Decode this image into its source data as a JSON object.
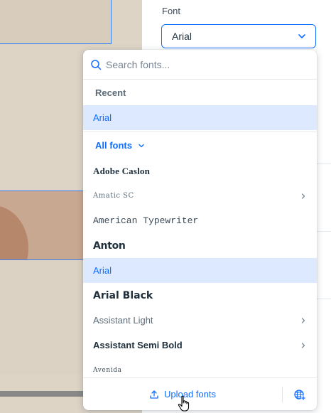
{
  "panel": {
    "label": "Font",
    "selected_value": "Arial"
  },
  "search": {
    "placeholder": "Search fonts..."
  },
  "recent": {
    "title": "Recent",
    "items": [
      {
        "label": "Arial",
        "selected": true
      }
    ]
  },
  "all_fonts": {
    "title": "All fonts",
    "items": [
      {
        "label": "Adobe Caslon"
      },
      {
        "label": "Amatic SC",
        "has_submenu": true
      },
      {
        "label": "American Typewriter"
      },
      {
        "label": "Anton"
      },
      {
        "label": "Arial",
        "selected": true
      },
      {
        "label": "Arial Black"
      },
      {
        "label": "Assistant Light",
        "has_submenu": true
      },
      {
        "label": "Assistant Semi Bold",
        "has_submenu": true
      },
      {
        "label": "Avenida"
      }
    ]
  },
  "footer": {
    "upload_label": "Upload fonts"
  },
  "colors": {
    "accent": "#116dff",
    "selected_bg": "#dce9ff",
    "canvas_bg": "#ddd4c6"
  },
  "icons": [
    "search-icon",
    "chevron-down-icon",
    "chevron-right-icon",
    "upload-icon",
    "globe-plus-icon",
    "hand-cursor-icon"
  ]
}
